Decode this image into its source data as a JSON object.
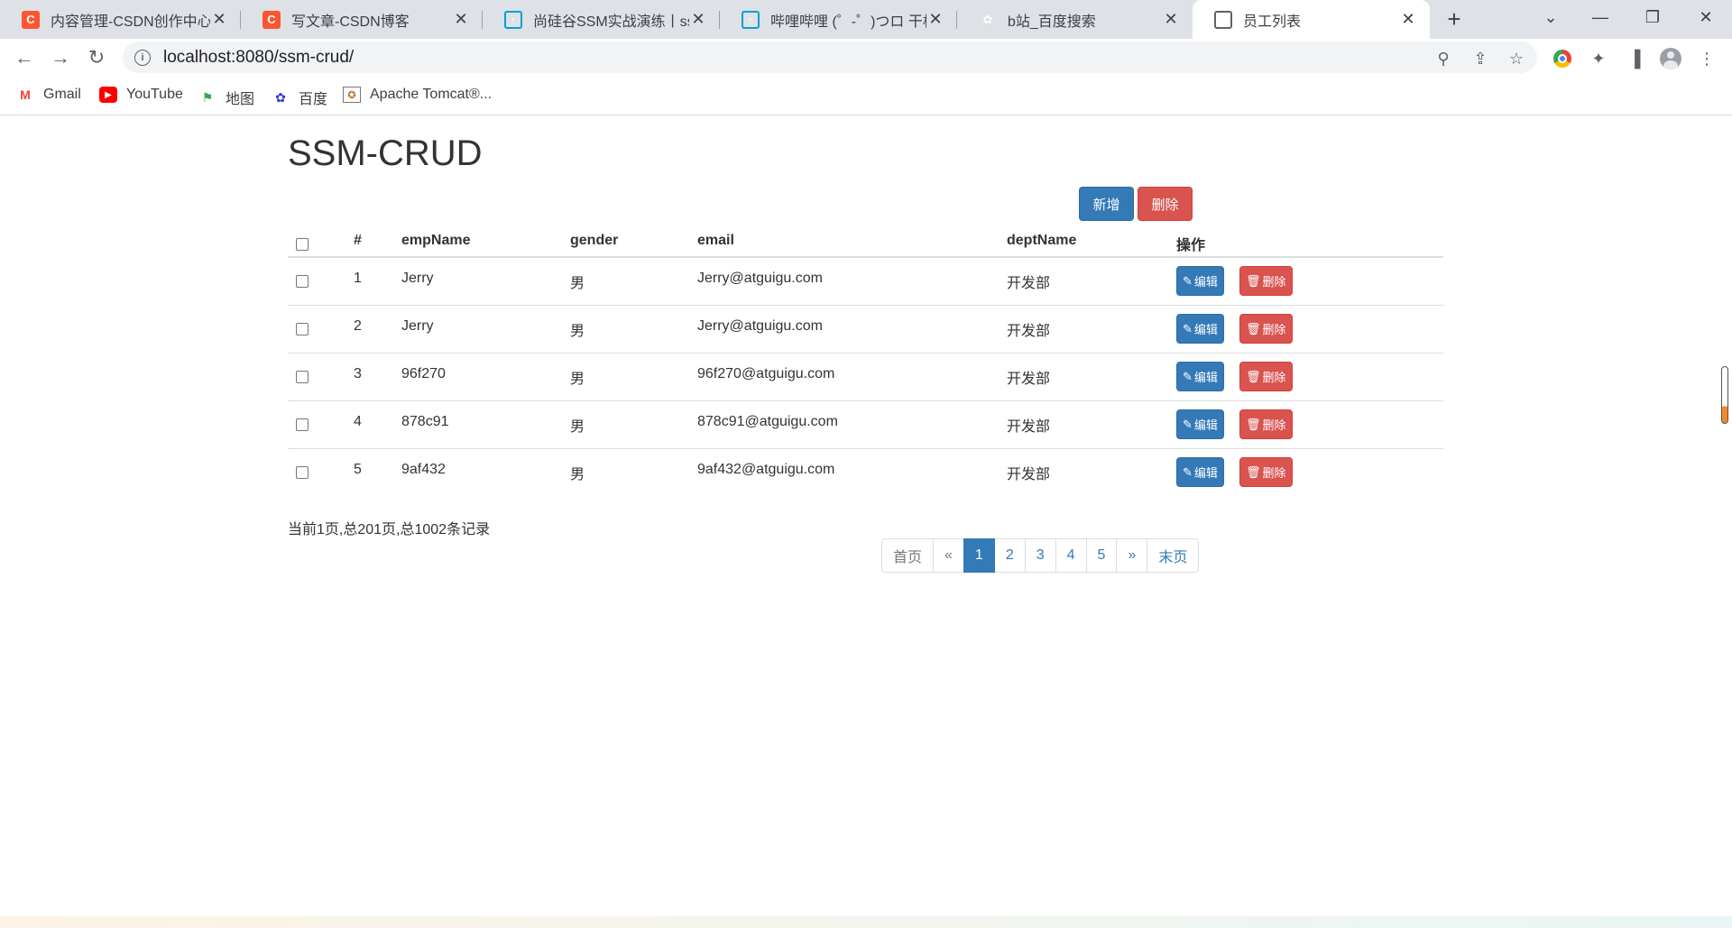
{
  "browser": {
    "tabs": [
      {
        "title": "内容管理-CSDN创作中心",
        "icon": "csdn-icon"
      },
      {
        "title": "写文章-CSDN博客",
        "icon": "csdn-icon"
      },
      {
        "title": "尚硅谷SSM实战演练丨ssm",
        "icon": "bilibili-icon"
      },
      {
        "title": "哔哩哔哩 (゜-゜)つロ 干杯~",
        "icon": "bilibili-icon"
      },
      {
        "title": "b站_百度搜索",
        "icon": "baidu-icon"
      },
      {
        "title": "员工列表",
        "icon": "globe-icon",
        "active": true
      }
    ],
    "address": "localhost:8080/ssm-crud/",
    "bookmarks": [
      {
        "label": "Gmail",
        "icon": "gmail-icon"
      },
      {
        "label": "YouTube",
        "icon": "youtube-icon"
      },
      {
        "label": "地图",
        "icon": "maps-icon"
      },
      {
        "label": "百度",
        "icon": "baidu-icon"
      },
      {
        "label": "Apache Tomcat®...",
        "icon": "tomcat-icon"
      }
    ]
  },
  "page": {
    "title": "SSM-CRUD",
    "add_label": "新增",
    "delete_label": "删除",
    "columns": [
      "#",
      "empName",
      "gender",
      "email",
      "deptName",
      "操作"
    ],
    "rows": [
      {
        "id": "1",
        "empName": "Jerry",
        "gender": "男",
        "email": "Jerry@atguigu.com",
        "deptName": "开发部"
      },
      {
        "id": "2",
        "empName": "Jerry",
        "gender": "男",
        "email": "Jerry@atguigu.com",
        "deptName": "开发部"
      },
      {
        "id": "3",
        "empName": "96f270",
        "gender": "男",
        "email": "96f270@atguigu.com",
        "deptName": "开发部"
      },
      {
        "id": "4",
        "empName": "878c91",
        "gender": "男",
        "email": "878c91@atguigu.com",
        "deptName": "开发部"
      },
      {
        "id": "5",
        "empName": "9af432",
        "gender": "男",
        "email": "9af432@atguigu.com",
        "deptName": "开发部"
      }
    ],
    "row_edit_label": "编辑",
    "row_delete_label": "删除",
    "page_info": "当前1页,总201页,总1002条记录",
    "pagination": [
      "首页",
      "«",
      "1",
      "2",
      "3",
      "4",
      "5",
      "»",
      "末页"
    ],
    "current_page": "1"
  },
  "colors": {
    "primary": "#337ab7",
    "danger": "#d9534f"
  }
}
